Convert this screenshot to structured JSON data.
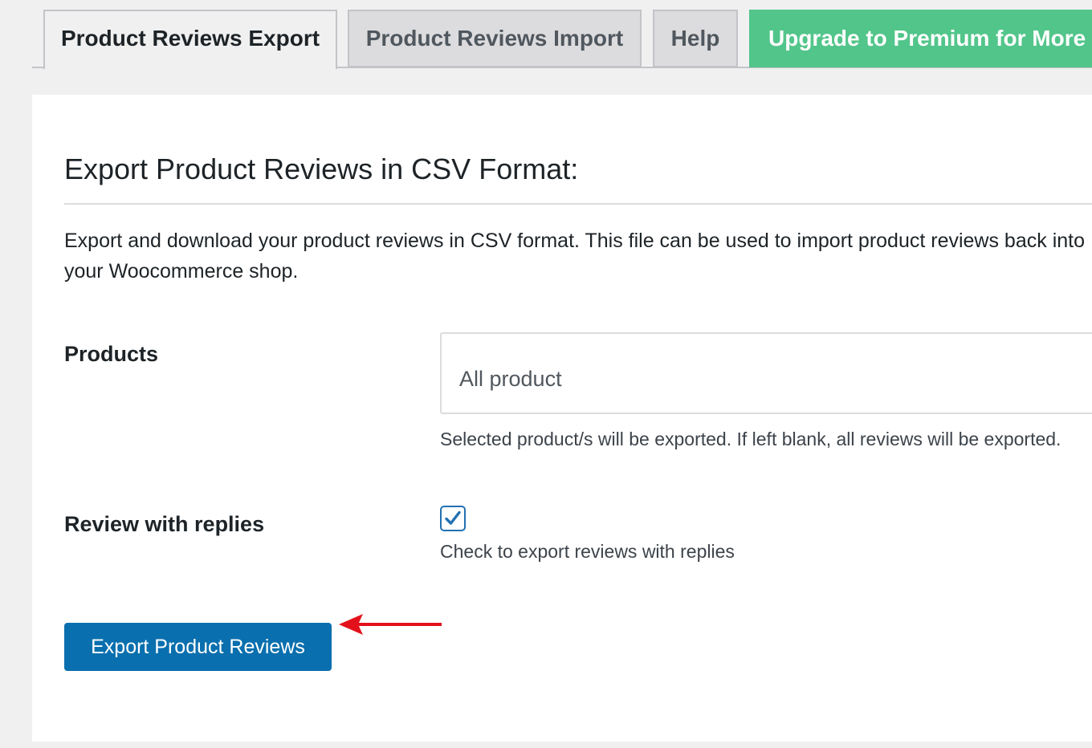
{
  "tabs": [
    {
      "label": "Product Reviews Export",
      "active": true
    },
    {
      "label": "Product Reviews Import",
      "active": false
    },
    {
      "label": "Help",
      "active": false
    },
    {
      "label": "Upgrade to Premium for More",
      "active": false
    }
  ],
  "panel": {
    "title": "Export Product Reviews in CSV Format:",
    "description": "Export and download your product reviews in CSV format. This file can be used to import product reviews back into your Woocommerce shop."
  },
  "products_field": {
    "label": "Products",
    "placeholder": "All product",
    "help": "Selected product/s will be exported. If left blank, all reviews will be exported."
  },
  "replies_field": {
    "label": "Review with replies",
    "checked": true,
    "help": "Check to export reviews with replies"
  },
  "export_button": {
    "label": "Export Product Reviews"
  },
  "colors": {
    "primary": "#0a6fae",
    "premium": "#52c58a",
    "annotation_arrow": "#e3111b"
  }
}
